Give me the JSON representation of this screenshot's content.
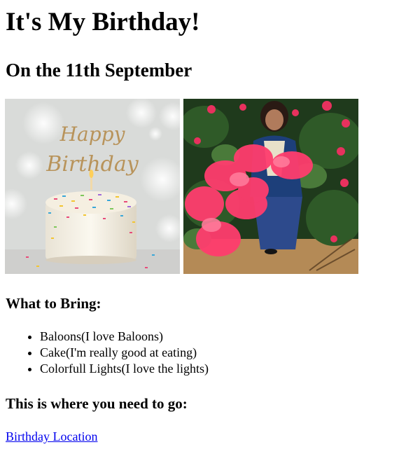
{
  "page": {
    "title": "It's My Birthday!",
    "subtitle": "On the 11th September"
  },
  "photos": {
    "cake_caption": "Happy Birthday"
  },
  "bring": {
    "heading": "What to Bring:",
    "items": [
      "Baloons(I love Baloons)",
      "Cake(I'm really good at eating)",
      "Colorfull Lights(I love the lights)"
    ]
  },
  "location": {
    "heading": "This is where you need to go:",
    "link_label": "Birthday Location"
  },
  "colors": {
    "link": "#0000ee",
    "text": "#000000",
    "background": "#ffffff"
  }
}
